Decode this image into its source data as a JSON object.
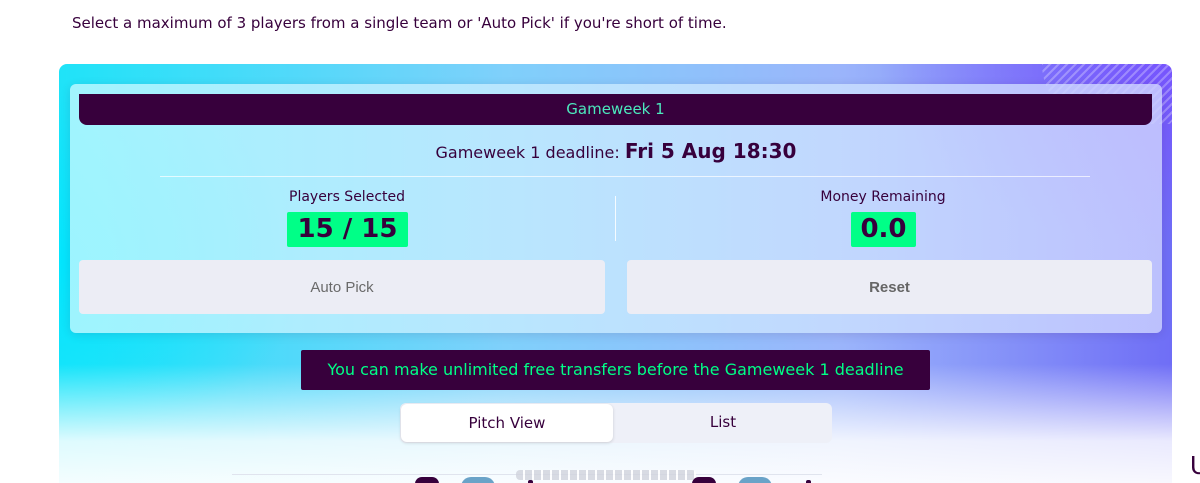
{
  "intro_text": "Select a maximum of 3 players from a single team or 'Auto Pick' if you're short of time.",
  "gameweek": {
    "title": "Gameweek 1",
    "deadline_label": "Gameweek 1 deadline:",
    "deadline_date": "Fri 5 Aug 18:30"
  },
  "stats": {
    "players_selected_label": "Players Selected",
    "players_selected_value": "15 / 15",
    "money_remaining_label": "Money Remaining",
    "money_remaining_value": "0.0"
  },
  "actions": {
    "auto_pick_label": "Auto Pick",
    "reset_label": "Reset"
  },
  "transfers_note": "You can make unlimited free transfers before the Gameweek 1 deadline",
  "view_toggle": {
    "options": [
      "Pitch View",
      "List"
    ],
    "selected": "Pitch View"
  },
  "colors": {
    "brand_purple": "#37003c",
    "brand_green": "#00ff87",
    "brand_teal": "#4ce8bd"
  }
}
